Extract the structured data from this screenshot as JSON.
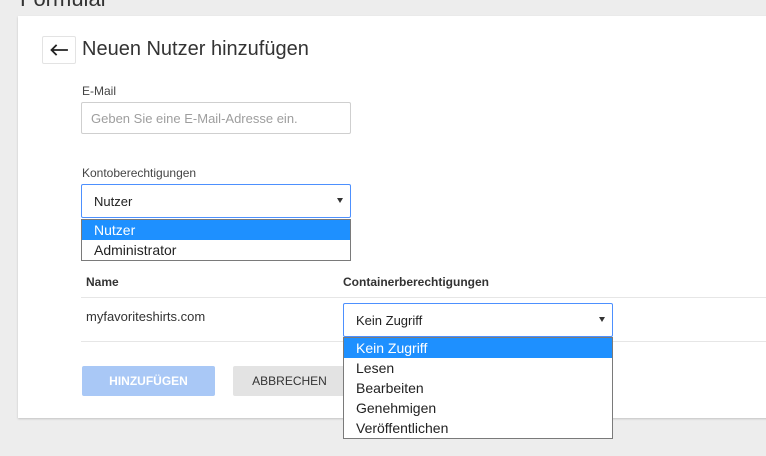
{
  "page": {
    "clipped_heading": "Formular"
  },
  "card": {
    "title": "Neuen Nutzer hinzufügen"
  },
  "email": {
    "label": "E-Mail",
    "placeholder": "Geben Sie eine E-Mail-Adresse ein.",
    "value": ""
  },
  "account_permissions": {
    "label": "Kontoberechtigungen",
    "selected": "Nutzer",
    "options": [
      "Nutzer",
      "Administrator"
    ],
    "selected_index": 0
  },
  "table": {
    "header_name": "Name",
    "header_permissions": "Containerberechtigungen",
    "rows": [
      {
        "name": "myfavoriteshirts.com",
        "permission": "Kein Zugriff"
      }
    ]
  },
  "container_permissions": {
    "selected": "Kein Zugriff",
    "options": [
      "Kein Zugriff",
      "Lesen",
      "Bearbeiten",
      "Genehmigen",
      "Veröffentlichen"
    ],
    "selected_index": 0
  },
  "actions": {
    "add_label": "HINZUFÜGEN",
    "cancel_label": "ABBRECHEN"
  },
  "colors": {
    "accent": "#4d90fe",
    "selected_option": "#1e90ff",
    "add_button_disabled": "#a9c8f6"
  },
  "icons": {
    "back": "arrow-left-icon",
    "select_caret": "caret-down-icon"
  }
}
